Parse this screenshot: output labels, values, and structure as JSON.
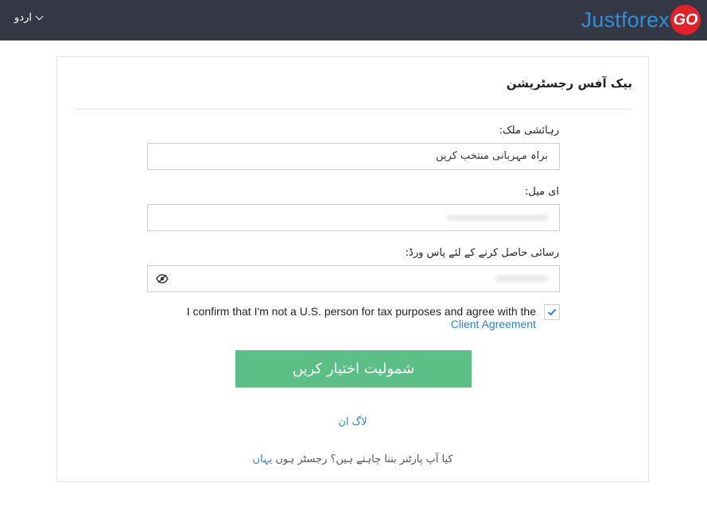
{
  "header": {
    "language": "اردو",
    "logo_text": "Justforex",
    "logo_badge": "GO"
  },
  "form": {
    "title": "بیک آفس رجسٹریشن",
    "country_label": "رہائشی ملک:",
    "country_value": "براہ مہربانی منتخب کریں",
    "email_label": "ای میل:",
    "password_label": "رسائی حاصل کرنے کے لئے پاس ورڈ:",
    "confirm_text": "I confirm that I'm not a U.S. person for tax purposes and agree with the",
    "confirm_link": "Client Agreement",
    "submit_label": "شمولیت اختیار کریں",
    "login_link": "لاگ ان",
    "partner_text": "کیا آپ پارٹنر بننا چاہتے ہیں؟ رجسٹر ہوں",
    "partner_link": "یہاں"
  },
  "colors": {
    "topbar": "#333844",
    "brand_blue": "#2f8fd9",
    "badge_red": "#e42029",
    "submit_green": "#5cbf85",
    "link_blue": "#2d7fd3"
  }
}
